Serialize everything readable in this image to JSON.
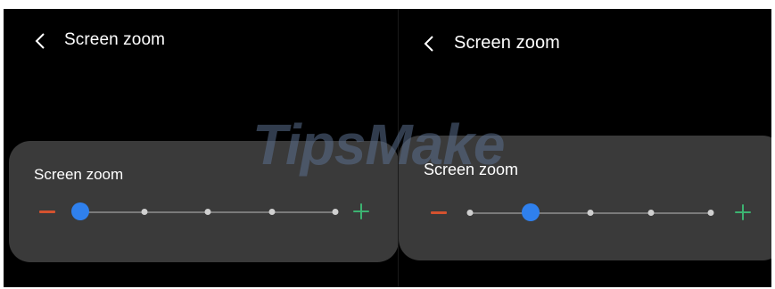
{
  "left_screen": {
    "title": "Screen zoom",
    "card_label": "Screen zoom",
    "zoom_level": 1,
    "zoom_steps": 5
  },
  "right_screen": {
    "title": "Screen zoom",
    "card_label": "Screen zoom",
    "zoom_level": 2,
    "zoom_steps": 5
  },
  "icons": {
    "back": "chevron-left-icon",
    "decrease": "minus-icon",
    "increase": "plus-icon"
  },
  "colors": {
    "background": "#000000",
    "card": "#3a3a3a",
    "thumb": "#2f80ed",
    "minus": "#d4522f",
    "plus": "#3cb371",
    "tick": "#cfcfcf"
  },
  "watermark": "TipsMake"
}
